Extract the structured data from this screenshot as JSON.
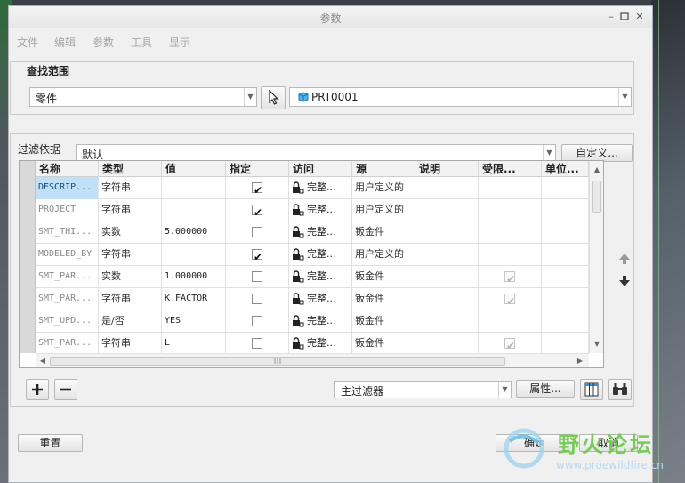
{
  "window": {
    "title": "参数"
  },
  "menu": [
    "文件",
    "编辑",
    "参数",
    "工具",
    "显示"
  ],
  "scope": {
    "label": "查找范围",
    "type_value": "零件",
    "model_value": "PRT0001"
  },
  "filter": {
    "label": "过滤依据",
    "value": "默认",
    "customize_label": "自定义..."
  },
  "table": {
    "columns": [
      "名称",
      "类型",
      "值",
      "指定",
      "访问",
      "源",
      "说明",
      "受限...",
      "单位..."
    ],
    "rows": [
      {
        "name": "DESCRIP...",
        "type": "字符串",
        "value": "",
        "designate": "checked",
        "access": "完整...",
        "source": "用户定义的",
        "restricted": ""
      },
      {
        "name": "PROJECT",
        "type": "字符串",
        "value": "",
        "designate": "checked",
        "access": "完整...",
        "source": "用户定义的",
        "restricted": ""
      },
      {
        "name": "SMT_THI...",
        "type": "实数",
        "value": "5.000000",
        "designate": "unchecked",
        "access": "完整...",
        "source": "钣金件",
        "restricted": ""
      },
      {
        "name": "MODELED_BY",
        "type": "字符串",
        "value": "",
        "designate": "checked",
        "access": "完整...",
        "source": "用户定义的",
        "restricted": ""
      },
      {
        "name": "SMT_PAR...",
        "type": "实数",
        "value": "1.000000",
        "designate": "unchecked",
        "access": "完整...",
        "source": "钣金件",
        "restricted": "disabled-checked"
      },
      {
        "name": "SMT_PAR...",
        "type": "字符串",
        "value": "K FACTOR",
        "designate": "unchecked",
        "access": "完整...",
        "source": "钣金件",
        "restricted": "disabled-checked"
      },
      {
        "name": "SMT_UPD...",
        "type": "是/否",
        "value": "YES",
        "designate": "unchecked",
        "access": "完整...",
        "source": "钣金件",
        "restricted": ""
      },
      {
        "name": "SMT_PAR...",
        "type": "字符串",
        "value": "L",
        "designate": "unchecked",
        "access": "完整...",
        "source": "钣金件",
        "restricted": "disabled-checked"
      }
    ]
  },
  "bottom_bar": {
    "main_filter_value": "主过滤器",
    "properties_label": "属性..."
  },
  "footer": {
    "reset_label": "重置",
    "ok_label": "确定",
    "cancel_label": "取消"
  },
  "watermark": {
    "text": "野火论坛",
    "url": "www.proewildfire.cn"
  },
  "colors": {
    "selected_cell": "#bfe0f6",
    "header_bg": "#f2f2f2",
    "dialog_bg": "#f0f0f0",
    "watermark_green": "#6cc84a"
  }
}
